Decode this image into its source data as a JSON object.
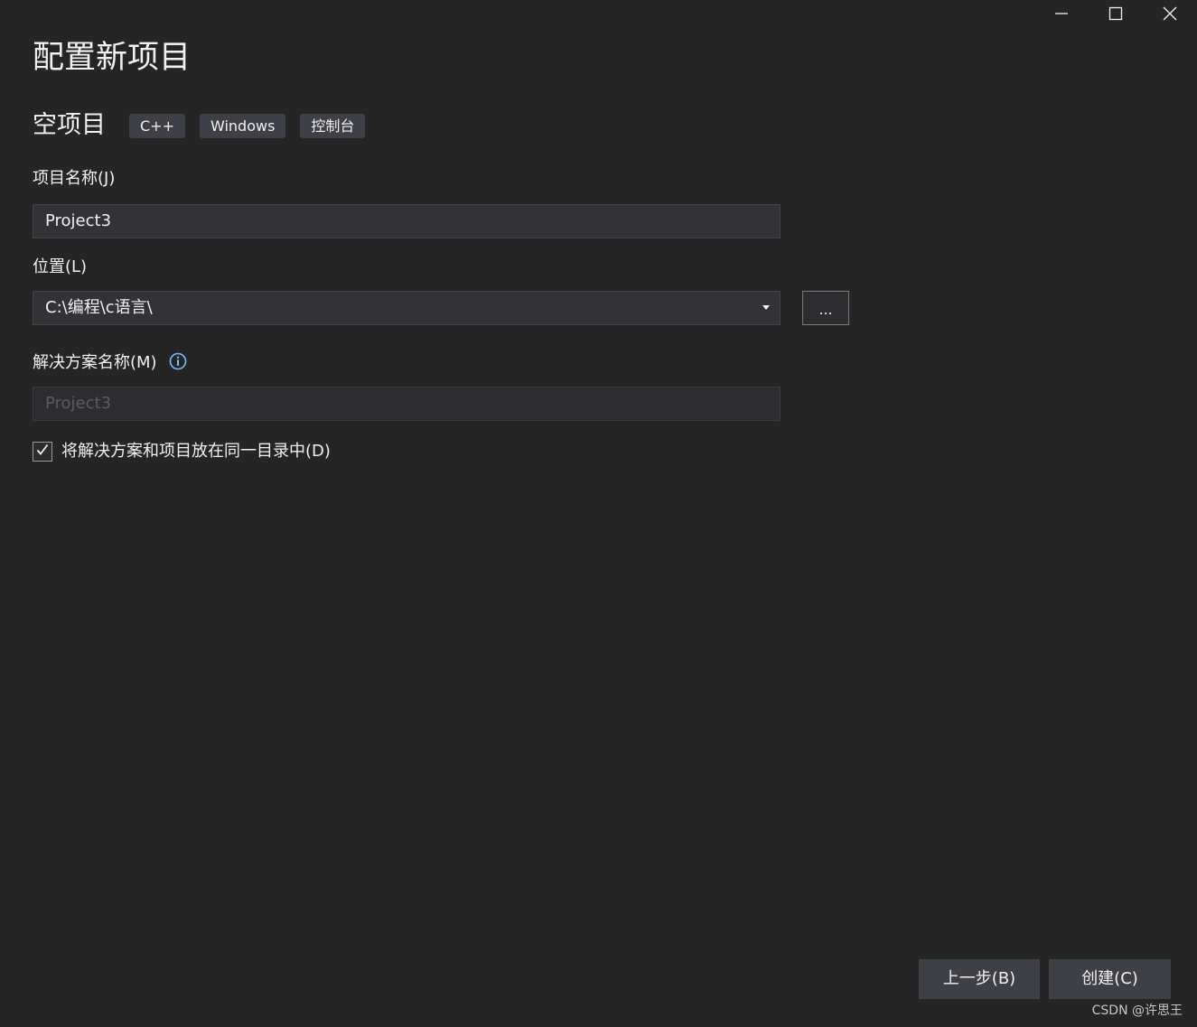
{
  "window": {
    "controls": {
      "minimize_icon": "minimize-icon",
      "maximize_icon": "maximize-icon",
      "close_icon": "close-icon"
    }
  },
  "header": {
    "title": "配置新项目"
  },
  "template": {
    "name": "空项目",
    "tags": [
      "C++",
      "Windows",
      "控制台"
    ]
  },
  "form": {
    "project_name": {
      "label": "项目名称(J)",
      "value": "Project3"
    },
    "location": {
      "label": "位置(L)",
      "value": "C:\\编程\\c语言\\",
      "browse_label": "..."
    },
    "solution_name": {
      "label": "解决方案名称(M)",
      "value": "Project3",
      "info_icon": "info-icon"
    },
    "same_directory": {
      "label": "将解决方案和项目放在同一目录中(D)",
      "checked": true
    }
  },
  "footer": {
    "back_label": "上一步(B)",
    "create_label": "创建(C)"
  },
  "watermark": "CSDN @许思王",
  "colors": {
    "background": "#252526",
    "input_background": "#333337",
    "tag_background": "#3f3f46",
    "info_accent": "#75beff",
    "text": "#f1f1f1"
  }
}
